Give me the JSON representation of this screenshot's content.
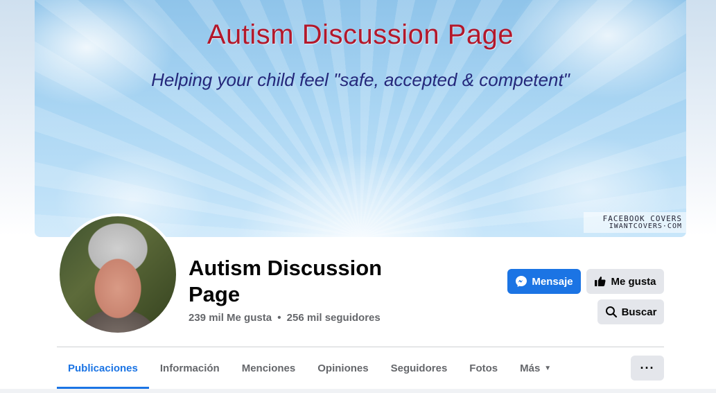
{
  "cover": {
    "title": "Autism Discussion Page",
    "subtitle": "Helping your child feel \"safe, accepted & competent\"",
    "watermark_line1": "FACEBOOK COVERS",
    "watermark_line2": "IWANTCOVERS·COM"
  },
  "profile": {
    "name": "Autism Discussion Page",
    "likes": "239 mil Me gusta",
    "separator": "•",
    "followers": "256 mil seguidores"
  },
  "actions": {
    "message_label": "Mensaje",
    "like_label": "Me gusta",
    "search_label": "Buscar",
    "more_label": "···"
  },
  "tabs": [
    {
      "label": "Publicaciones",
      "active": true
    },
    {
      "label": "Información",
      "active": false
    },
    {
      "label": "Menciones",
      "active": false
    },
    {
      "label": "Opiniones",
      "active": false
    },
    {
      "label": "Seguidores",
      "active": false
    },
    {
      "label": "Fotos",
      "active": false
    },
    {
      "label": "Más",
      "active": false
    }
  ],
  "colors": {
    "accent": "#1b74e4",
    "cover_title": "#b3182b",
    "cover_subtitle": "#24277a"
  },
  "icons": {
    "message": "messenger-icon",
    "like": "thumbs-up-icon",
    "search": "search-icon",
    "more_tab": "caret-down-icon",
    "more_button": "ellipsis-icon"
  }
}
